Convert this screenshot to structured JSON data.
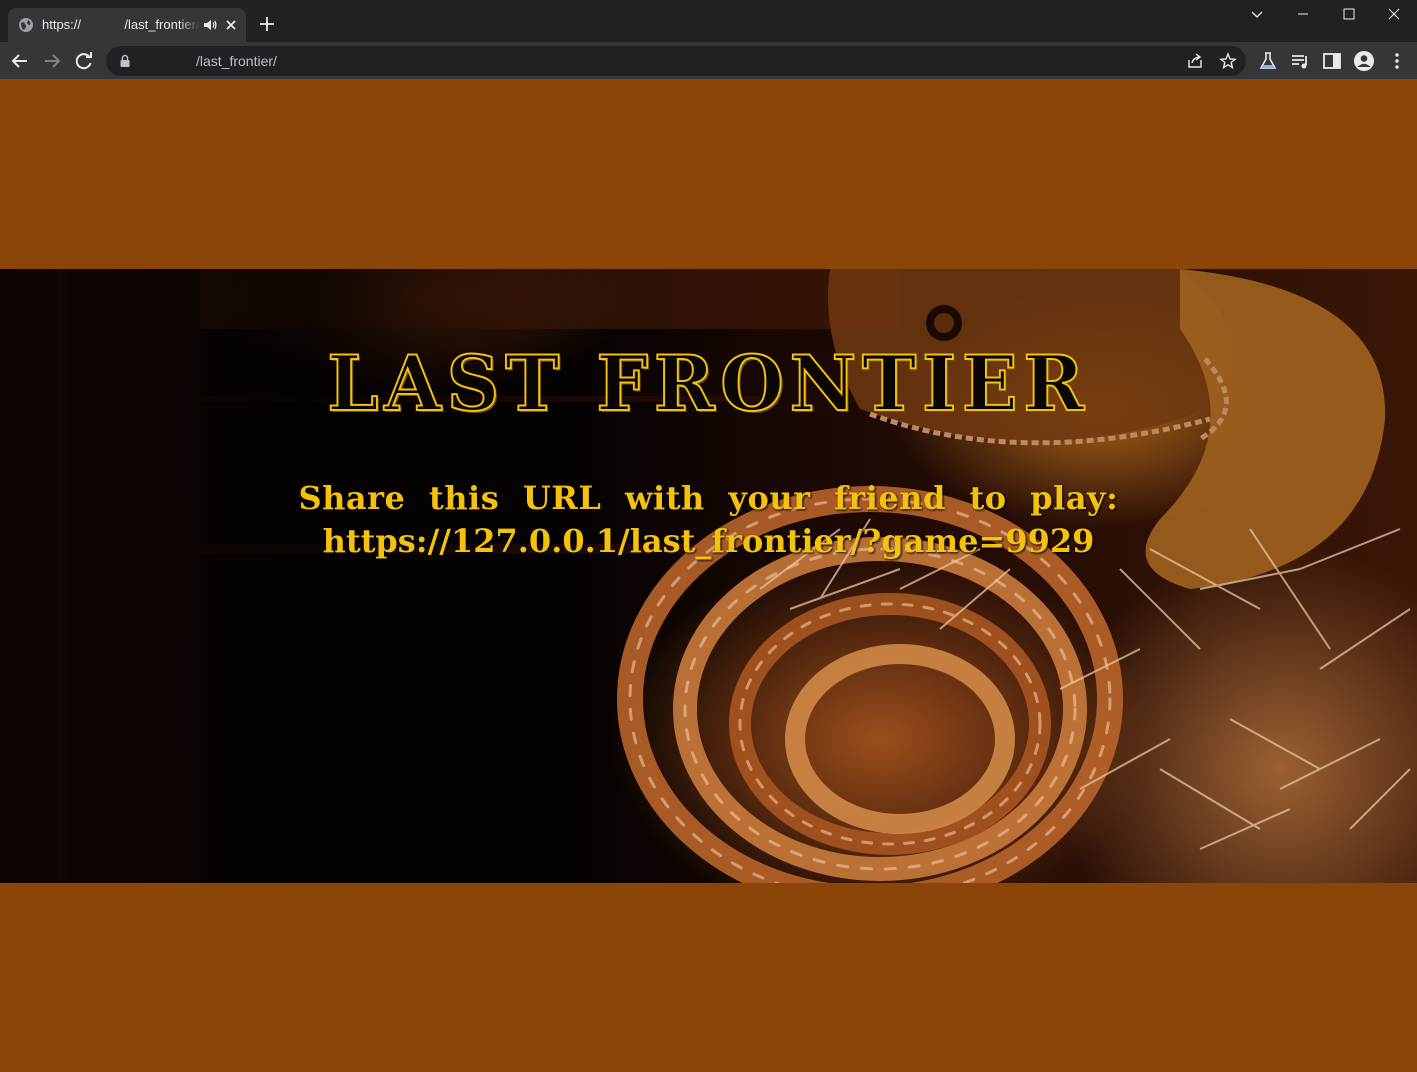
{
  "browser": {
    "tab": {
      "title": "https://            /last_frontier/",
      "favicon": "globe-icon"
    },
    "omnibox": {
      "url": "/last_frontier/"
    }
  },
  "page": {
    "title": "LAST FRONTIER",
    "share_line1": "Share this URL with your friend to play:",
    "share_line2": "https://127.0.0.1/last_frontier/?game=9929",
    "colors": {
      "background": "#8b4509",
      "accent": "#f4c20d"
    }
  }
}
